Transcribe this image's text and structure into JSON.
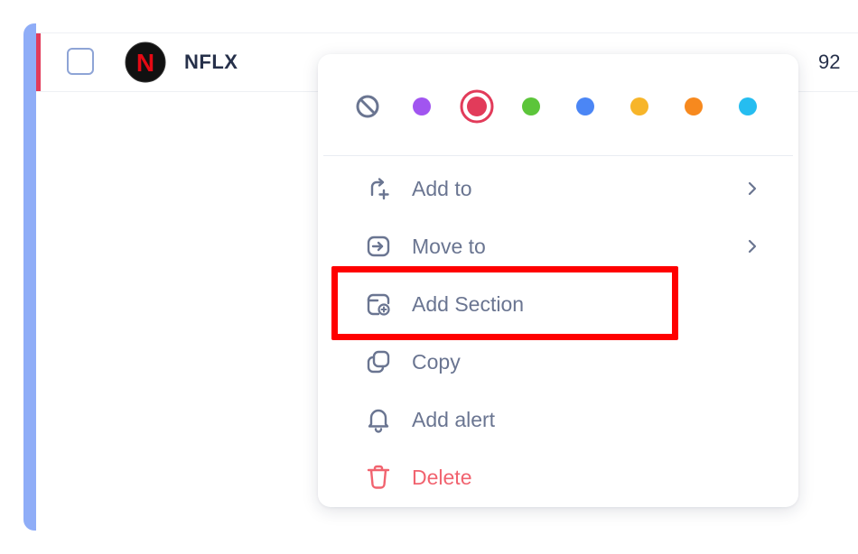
{
  "watchlist_row": {
    "ticker": "NFLX",
    "price_partial": "92",
    "logo_letter": "N",
    "accent_color": "#e23b5a"
  },
  "context_menu": {
    "color_swatches": [
      {
        "name": "none",
        "color": "#6a7591",
        "icon": "no-color-icon",
        "selected": false
      },
      {
        "name": "purple",
        "color": "#a155f0",
        "selected": false
      },
      {
        "name": "red",
        "color": "#e23b5a",
        "selected": true
      },
      {
        "name": "green",
        "color": "#5cc53a",
        "selected": false
      },
      {
        "name": "blue",
        "color": "#4b86f5",
        "selected": false
      },
      {
        "name": "yellow",
        "color": "#f7b529",
        "selected": false
      },
      {
        "name": "orange",
        "color": "#f7891e",
        "selected": false
      },
      {
        "name": "cyan",
        "color": "#25bdf0",
        "selected": false
      }
    ],
    "items": [
      {
        "label": "Add to",
        "icon": "add-to-icon",
        "has_submenu": true
      },
      {
        "label": "Move to",
        "icon": "move-to-icon",
        "has_submenu": true
      },
      {
        "label": "Add Section",
        "icon": "add-section-icon",
        "has_submenu": false
      },
      {
        "label": "Copy",
        "icon": "copy-icon",
        "has_submenu": false
      },
      {
        "label": "Add alert",
        "icon": "bell-icon",
        "has_submenu": false
      },
      {
        "label": "Delete",
        "icon": "trash-icon",
        "has_submenu": false,
        "danger": true
      }
    ]
  },
  "annotation": {
    "highlight_color": "#ff0000",
    "highlighted_item": "Add Section"
  },
  "colors": {
    "sidebar_accent": "#8fadf7",
    "text_primary": "#26304a",
    "text_menu": "#6a7591",
    "danger": "#f1636f"
  }
}
